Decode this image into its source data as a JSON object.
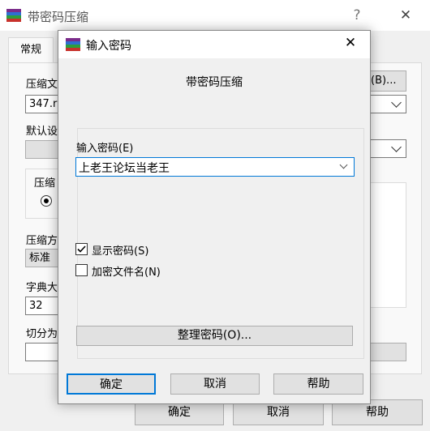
{
  "back_window": {
    "title": "带密码压缩",
    "help_glyph": "?",
    "close_glyph": "✕",
    "tab_general": "常规",
    "label_archive": "压缩文",
    "archive_value": "347.ra",
    "browse_label": "(B)...",
    "label_default": "默认设",
    "label_format": "压缩",
    "label_method": "压缩方",
    "method_value": "标准",
    "label_dict": "字典大",
    "dict_value": "32",
    "label_split": "切分为",
    "ok_label": "确定",
    "cancel_label": "取消",
    "help_label": "帮助"
  },
  "dialog": {
    "title": "输入密码",
    "close_glyph": "✕",
    "header": "带密码压缩",
    "password_label": "输入密码(E)",
    "password_value": "上老王论坛当老王",
    "show_password_label": "显示密码(S)",
    "show_password_checked": true,
    "encrypt_names_label": "加密文件名(N)",
    "encrypt_names_checked": false,
    "organize_button": "整理密码(O)...",
    "ok_button": "确定",
    "cancel_button": "取消",
    "help_button": "帮助"
  },
  "colors": {
    "accent": "#0078d7"
  }
}
